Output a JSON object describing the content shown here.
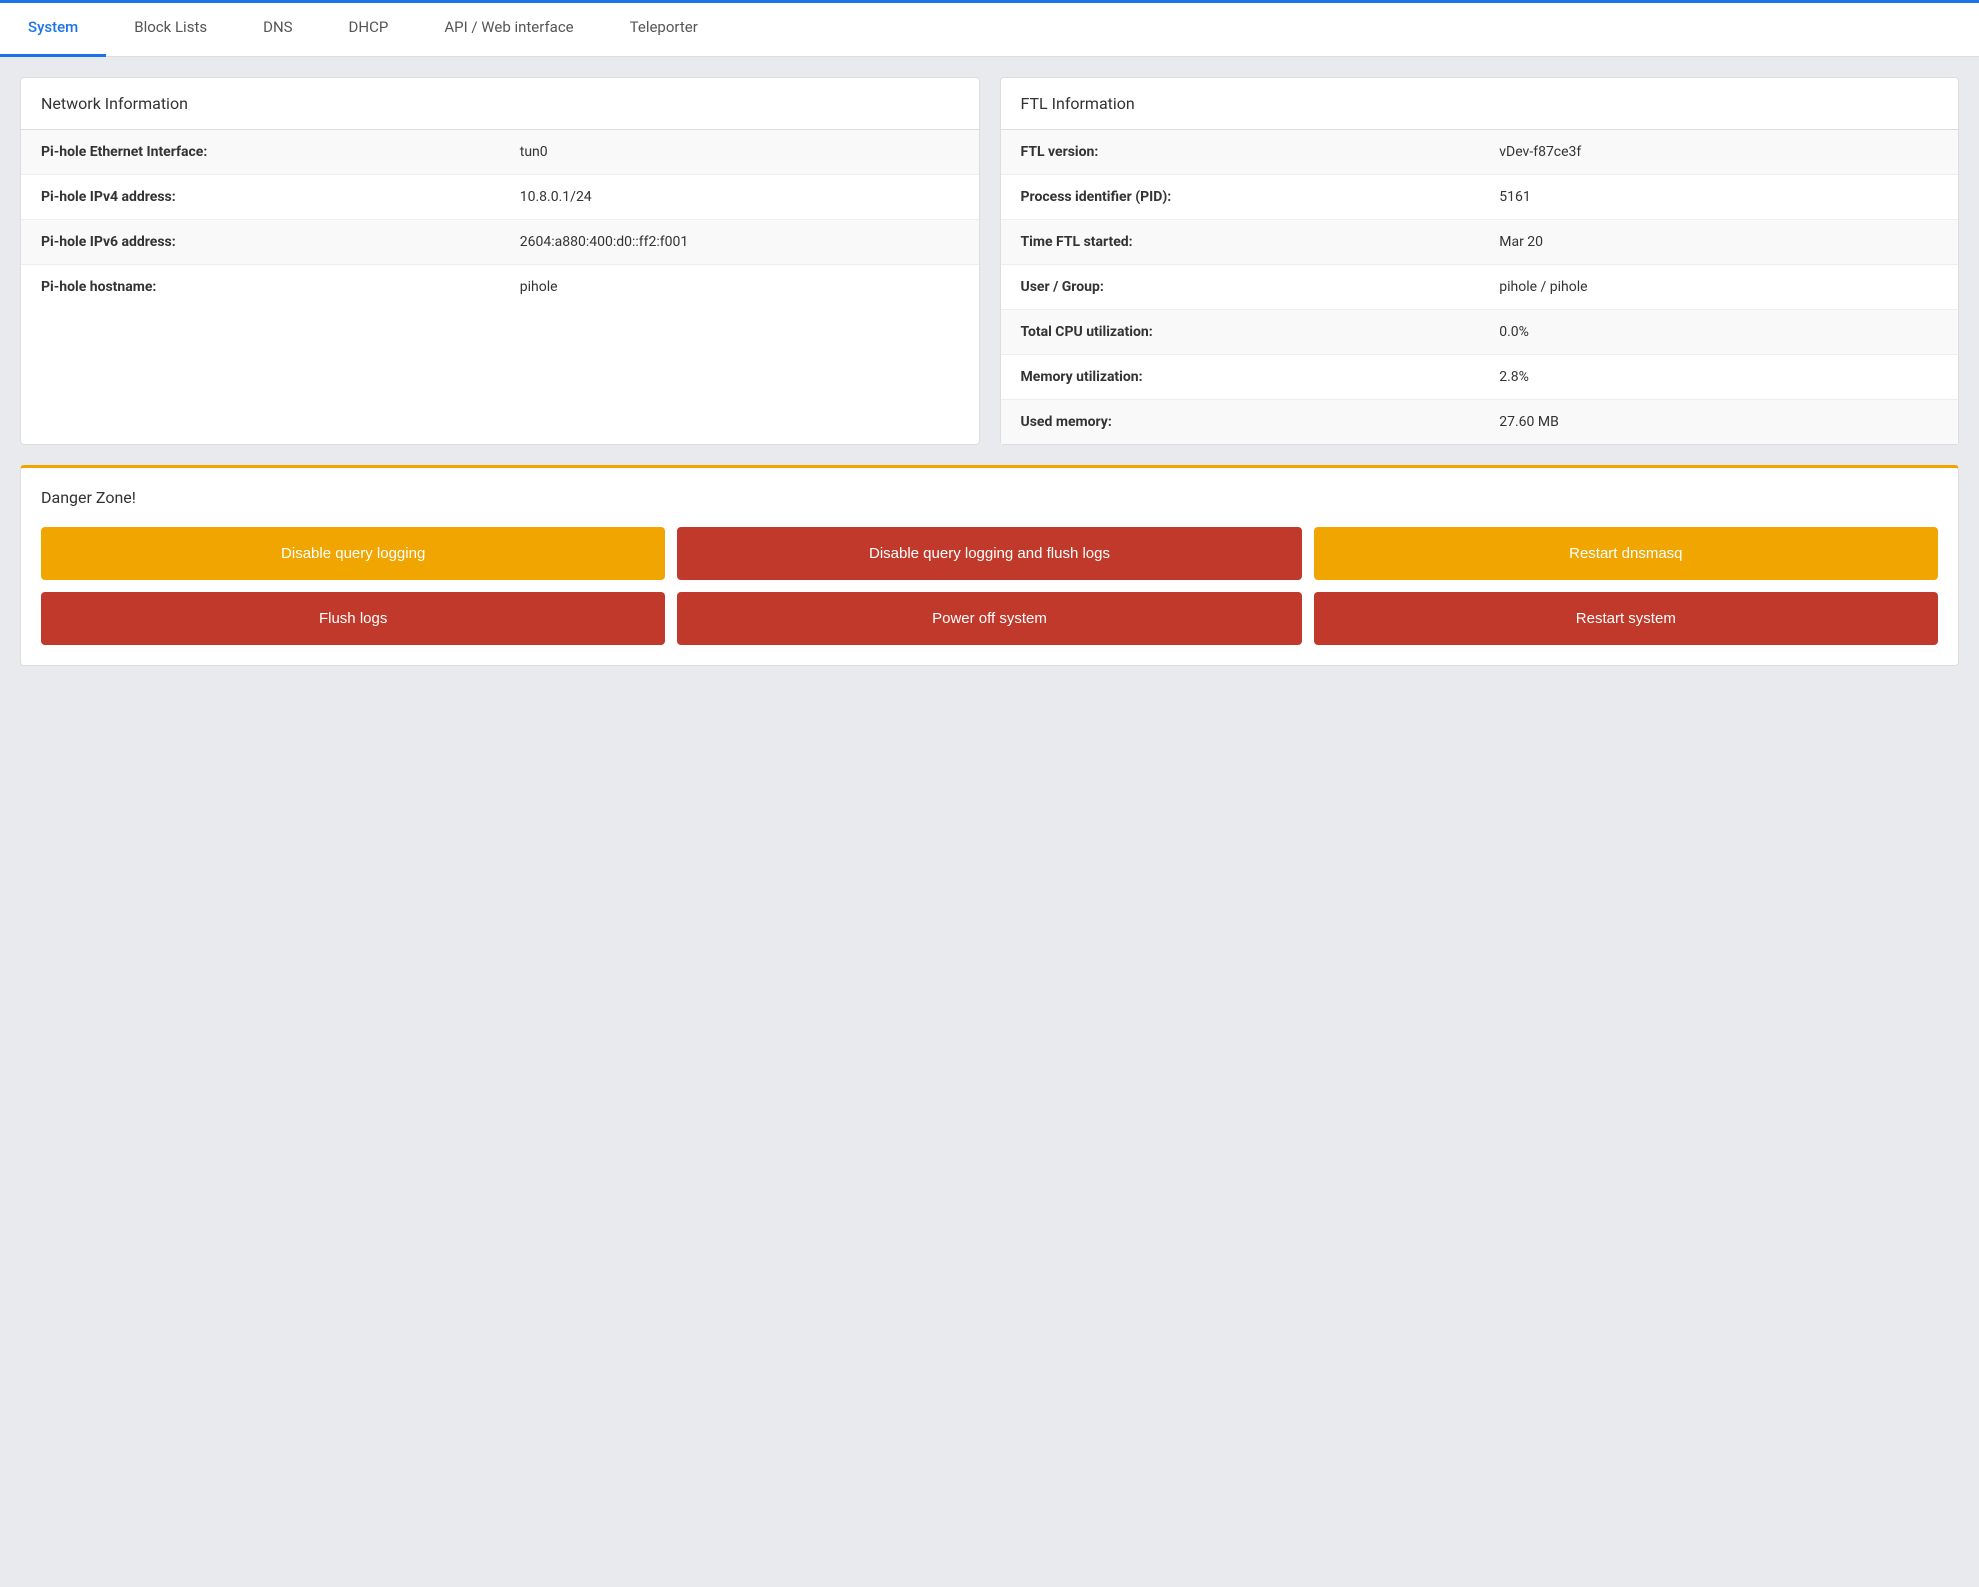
{
  "tabs": [
    {
      "label": "System",
      "active": true
    },
    {
      "label": "Block Lists",
      "active": false
    },
    {
      "label": "DNS",
      "active": false
    },
    {
      "label": "DHCP",
      "active": false
    },
    {
      "label": "API / Web interface",
      "active": false
    },
    {
      "label": "Teleporter",
      "active": false
    }
  ],
  "network_info": {
    "title": "Network Information",
    "rows": [
      {
        "key": "Pi-hole Ethernet Interface:",
        "value": "tun0"
      },
      {
        "key": "Pi-hole IPv4 address:",
        "value": "10.8.0.1/24"
      },
      {
        "key": "Pi-hole IPv6 address:",
        "value": "2604:a880:400:d0::ff2:f001"
      },
      {
        "key": "Pi-hole hostname:",
        "value": "pihole"
      }
    ]
  },
  "ftl_info": {
    "title": "FTL Information",
    "rows": [
      {
        "key": "FTL version:",
        "value": "vDev-f87ce3f"
      },
      {
        "key": "Process identifier (PID):",
        "value": "5161"
      },
      {
        "key": "Time FTL started:",
        "value": "Mar 20"
      },
      {
        "key": "User / Group:",
        "value": "pihole / pihole"
      },
      {
        "key": "Total CPU utilization:",
        "value": "0.0%"
      },
      {
        "key": "Memory utilization:",
        "value": "2.8%"
      },
      {
        "key": "Used memory:",
        "value": "27.60 MB"
      }
    ]
  },
  "danger_zone": {
    "title": "Danger Zone!",
    "buttons": [
      {
        "label": "Disable query logging",
        "style": "orange",
        "row": 0,
        "col": 0
      },
      {
        "label": "Disable query logging and flush logs",
        "style": "red",
        "row": 0,
        "col": 1
      },
      {
        "label": "Restart dnsmasq",
        "style": "orange",
        "row": 0,
        "col": 2
      },
      {
        "label": "Flush logs",
        "style": "red",
        "row": 1,
        "col": 0
      },
      {
        "label": "Power off system",
        "style": "red",
        "row": 1,
        "col": 1
      },
      {
        "label": "Restart system",
        "style": "red",
        "row": 1,
        "col": 2
      }
    ]
  }
}
